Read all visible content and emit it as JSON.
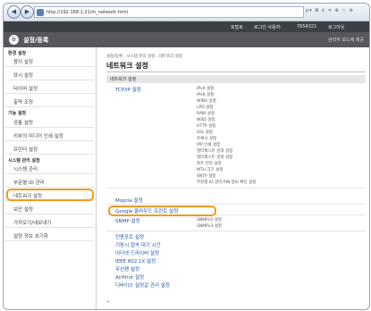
{
  "browser": {
    "back_icon": "back-arrow-icon",
    "forward_icon": "forward-arrow-icon",
    "url": "http://192.168.1.21/m_network.html",
    "right_tools": "ρ▾ ⊠ ¢ ✕  ⊕ ☆ ⊛"
  },
  "userbar": {
    "portal": "포털로",
    "login_user_label": "로그인 사용자:",
    "login_user": "7654321",
    "logout": "로그아웃"
  },
  "header": {
    "title": "설정/등록",
    "admin_mode": "관리자 모드에 제공"
  },
  "sidebar": {
    "section_pref": "환경 설정",
    "section_mgmt": "기능 설정",
    "section_sys": "시스템 관리 설정",
    "items": [
      {
        "label": "용지 설정"
      },
      {
        "label": "표시 설정"
      },
      {
        "label": "타이머 설정"
      },
      {
        "label": "출력 조정"
      },
      {
        "label": "공통 설정"
      },
      {
        "label": "외부의 미디어 인쇄 설정"
      },
      {
        "label": "프린터 설정"
      },
      {
        "label": "시스템 관리"
      },
      {
        "label": "부문별 ID 관리"
      },
      {
        "label": "네트워크 설정"
      },
      {
        "label": "보안 설정"
      },
      {
        "label": "가져오기/내보내기"
      },
      {
        "label": "설정 정보 초기화"
      }
    ]
  },
  "content": {
    "breadcrumb": "설정/등록 : 시스템 관리 설정 : 네트워크 설정",
    "title": "네트워크 설정",
    "section": "네트워크 설정",
    "tcpip_label": "TCP/IP 설정",
    "tcpip_items": [
      "IPv4 설정",
      "IPv6 설정",
      "WINS 설정",
      "LPD 설정",
      "RAW 설정",
      "WSD 설정",
      "HTTP 설정",
      "SSL 설정",
      "프록시 설정",
      "IPP 인쇄 설정",
      "멀티캐스트 검색 설정",
      "멀티캐스트 검색 설정",
      "포트 번호 설정",
      "MTU 크기 설정",
      "SNTP 설정",
      "부문별 ID 관리 PIN 정보 확인 설정"
    ],
    "mopria": "Mopria 설정",
    "google": "Google 클라우드 프린트 설정",
    "snmp": "SNMP 설정",
    "snmp_items": [
      "SNMPv1 설정",
      "SNMPv3 설정"
    ],
    "links": [
      "전용포트 설정",
      "기동시 접속 대기 시간",
      "이더넷 드라이버 설정",
      "IEEE 802.1X 설정",
      "무선랜 설정",
      "AirPrint 설정",
      "디바이스 설정값 관리 설정"
    ],
    "footer_mark": "≡"
  }
}
